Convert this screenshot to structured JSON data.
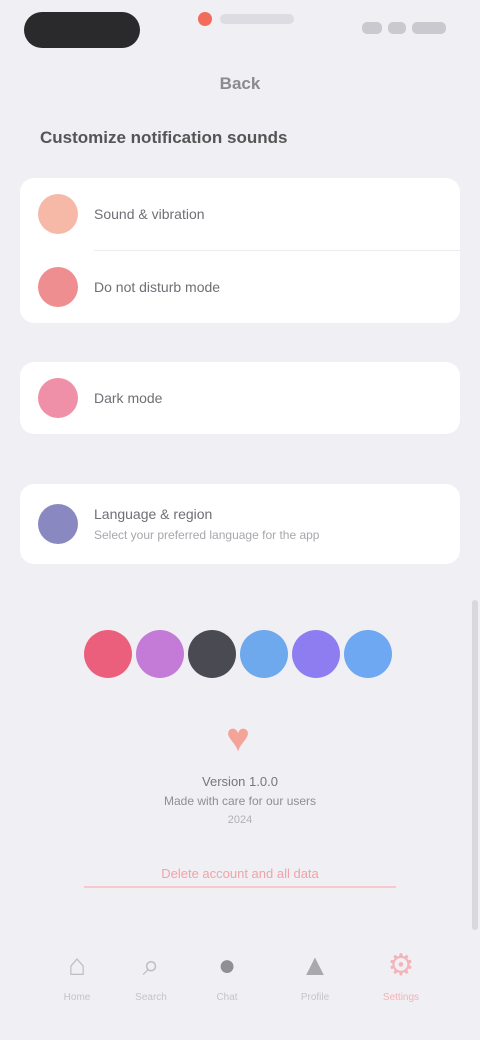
{
  "status_bar": {
    "recording_label": "Recording"
  },
  "nav": {
    "title": "Back"
  },
  "section": {
    "title": "Customize notification sounds"
  },
  "card1": {
    "rows": [
      {
        "label": "Sound & vibration",
        "icon": "bell-icon",
        "color": "#f6b9a8"
      },
      {
        "label": "Do not disturb mode",
        "icon": "moon-icon",
        "color": "#ef8e91"
      }
    ]
  },
  "card2": {
    "label": "Dark mode",
    "icon": "half-moon-icon",
    "color": "#f08fa8"
  },
  "card3": {
    "label": "Language & region",
    "sublabel": "Select your preferred language for the app",
    "icon": "globe-icon",
    "color": "#8a88c0"
  },
  "theme_colors": [
    "#ec5f7c",
    "#c47bd8",
    "#4a4a52",
    "#6ea9ee",
    "#8d7df0",
    "#6ea7f2"
  ],
  "about": {
    "app_name": "Version 1.0.0",
    "tagline": "Made with care for our users",
    "copyright": "2024"
  },
  "danger": {
    "label": "Delete account and all data"
  },
  "tabbar": {
    "items": [
      {
        "label": "Home",
        "icon": "home-icon"
      },
      {
        "label": "Search",
        "icon": "search-icon"
      },
      {
        "label": "Chat",
        "icon": "chat-icon"
      },
      {
        "label": "Profile",
        "icon": "user-icon"
      },
      {
        "label": "Settings",
        "icon": "gear-icon"
      }
    ]
  }
}
